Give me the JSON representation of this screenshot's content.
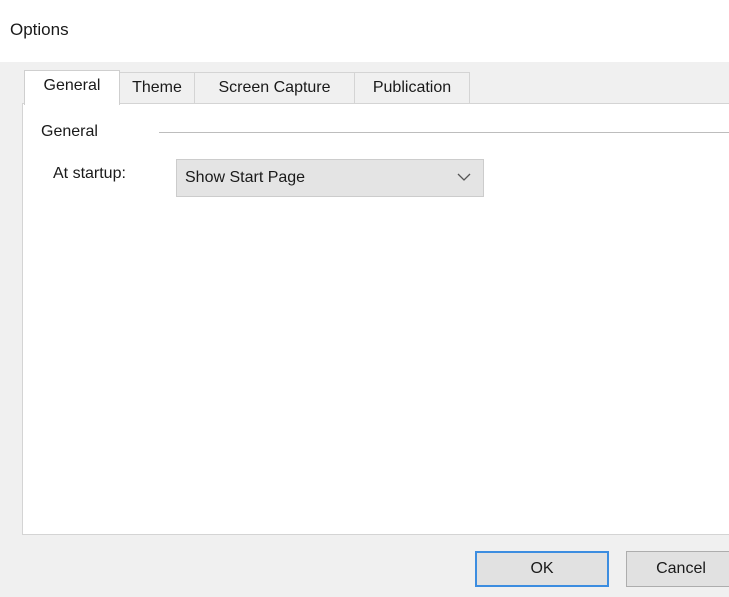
{
  "window": {
    "title": "Options"
  },
  "tabs": [
    {
      "label": "General",
      "active": true
    },
    {
      "label": "Theme",
      "active": false
    },
    {
      "label": "Screen Capture",
      "active": false
    },
    {
      "label": "Publication",
      "active": false
    }
  ],
  "general": {
    "group_label": "General",
    "startup_label": "At startup:",
    "startup_value": "Show Start Page"
  },
  "buttons": {
    "ok": "OK",
    "cancel": "Cancel"
  },
  "colors": {
    "default_button_border": "#3c8de0",
    "panel_bg": "#ffffff",
    "chrome_bg": "#f0f0f0"
  },
  "icons": {
    "dropdown": "chevron-down-icon"
  }
}
